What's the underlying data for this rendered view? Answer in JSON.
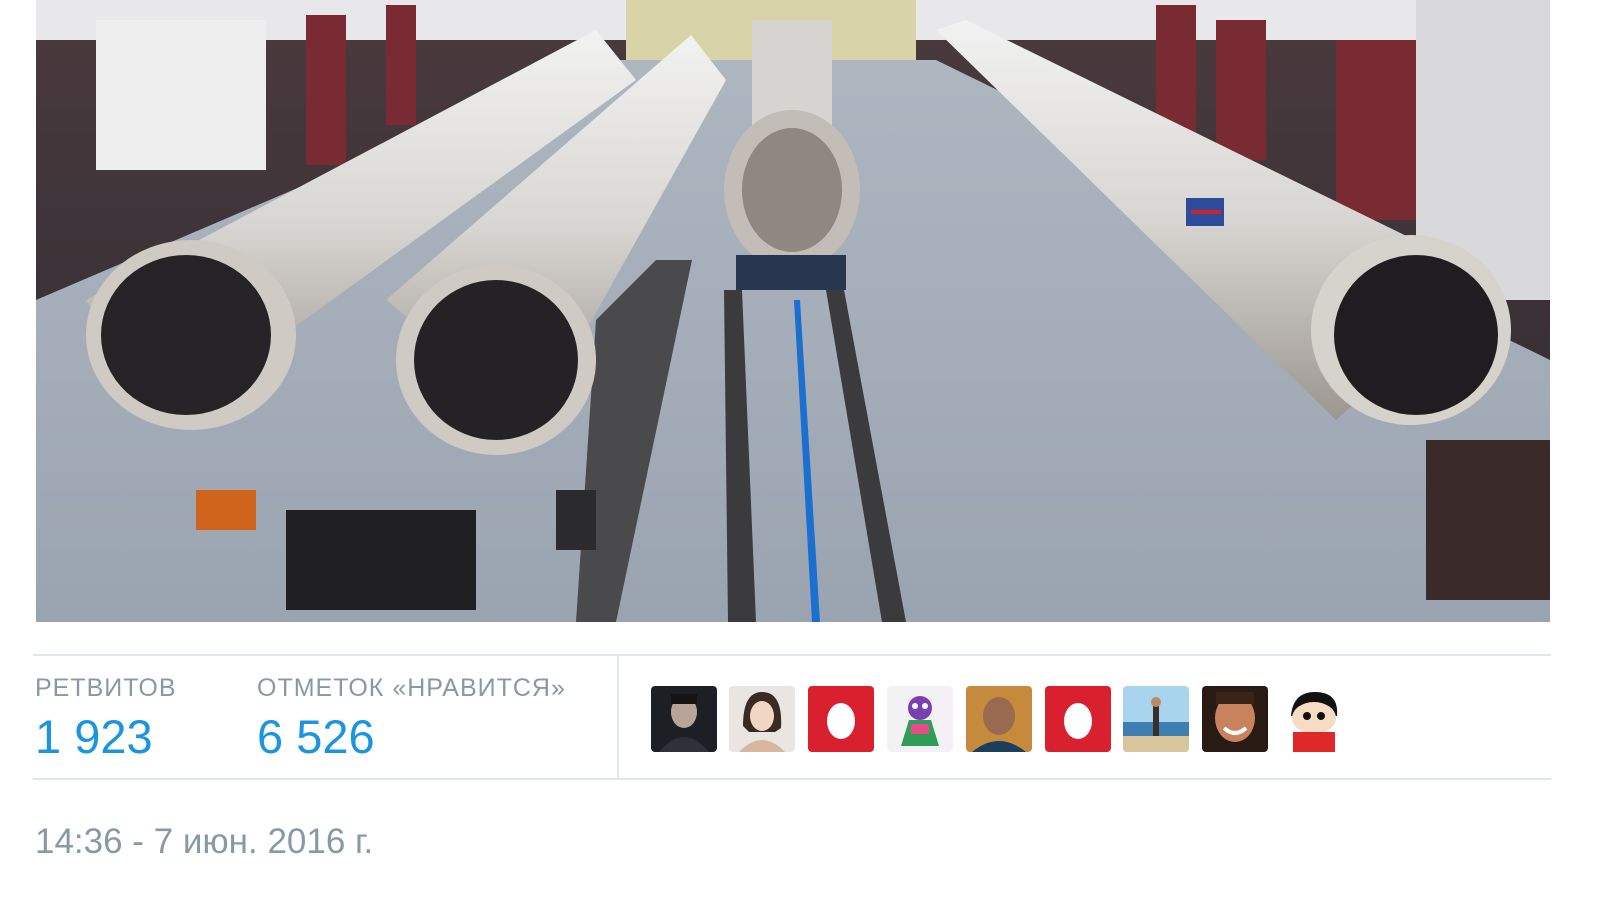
{
  "tweet": {
    "photo_alt": "photo",
    "stats": {
      "retweets_label": "РЕТВИТОВ",
      "retweets_value": "1 923",
      "likes_label": "ОТМЕТОК «НРАВИТСЯ»",
      "likes_value": "6 526"
    },
    "liked_by": [
      {
        "icon": "dark-portrait-avatar"
      },
      {
        "icon": "woman-portrait-avatar"
      },
      {
        "icon": "red-egg-avatar"
      },
      {
        "icon": "cartoon-avatar"
      },
      {
        "icon": "man-portrait-avatar"
      },
      {
        "icon": "red-egg-avatar"
      },
      {
        "icon": "beach-photo-avatar"
      },
      {
        "icon": "smiling-man-avatar"
      },
      {
        "icon": "anime-boy-avatar"
      }
    ],
    "timestamp": "14:36 - 7 июн. 2016 г."
  },
  "colors": {
    "accent": "#1b95e0",
    "muted": "#8899a6",
    "egg_red": "#d8202f",
    "border": "#e1e8ed"
  }
}
